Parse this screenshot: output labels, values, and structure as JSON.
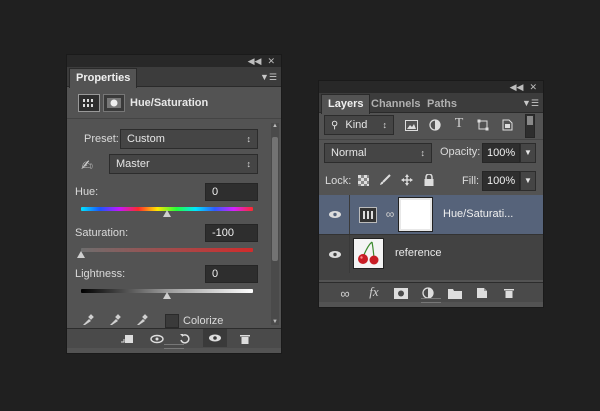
{
  "properties": {
    "tab": "Properties",
    "title": "Hue/Saturation",
    "preset_label": "Preset:",
    "preset_value": "Custom",
    "channel_value": "Master",
    "hue_label": "Hue:",
    "hue_value": "0",
    "hue_fraction": 0.5,
    "saturation_label": "Saturation:",
    "saturation_value": "-100",
    "saturation_fraction": 0.0,
    "lightness_label": "Lightness:",
    "lightness_value": "0",
    "lightness_fraction": 0.5,
    "colorize_label": "Colorize"
  },
  "layers": {
    "tabs": [
      "Layers",
      "Channels",
      "Paths"
    ],
    "filter_value": "Kind",
    "blend_mode": "Normal",
    "opacity_label": "Opacity:",
    "opacity_value": "100%",
    "lock_label": "Lock:",
    "fill_label": "Fill:",
    "fill_value": "100%",
    "items": [
      {
        "name": "Hue/Saturati..."
      },
      {
        "name": "reference"
      }
    ]
  },
  "colors": {
    "bg": "#202020",
    "panel": "#535353",
    "selected_row": "#56637a"
  }
}
